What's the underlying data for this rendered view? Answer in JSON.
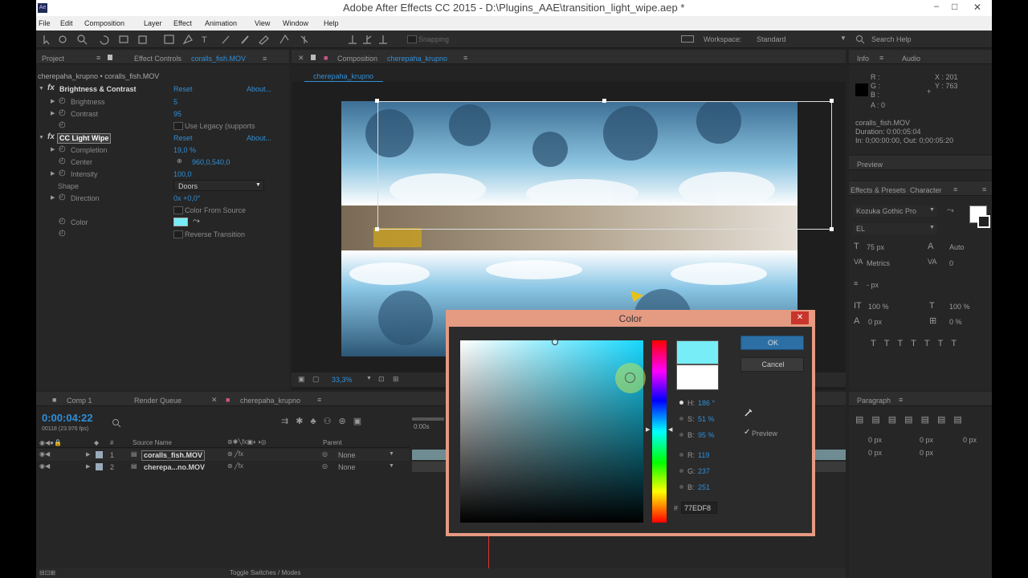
{
  "titlebar": {
    "app_icon": "Ae",
    "title": "Adobe After Effects CC 2015 - D:\\Plugins_AAE\\transition_light_wipe.aep *",
    "min": "–",
    "max": "□",
    "close": "✕"
  },
  "menu": [
    "File",
    "Edit",
    "Composition",
    "Layer",
    "Effect",
    "Animation",
    "View",
    "Window",
    "Help"
  ],
  "toolbar": {
    "snapping": "Snapping",
    "workspace_label": "Workspace:",
    "workspace_value": "Standard",
    "search": "Search Help"
  },
  "effect_controls": {
    "tab_project": "Project",
    "tab_effect": "Effect Controls",
    "tab_effect_layer": "coralls_fish.MOV",
    "breadcrumb": "cherepaha_krupno • coralls_fish.MOV",
    "effects": [
      {
        "name": "Brightness & Contrast",
        "reset": "Reset",
        "about": "About..."
      },
      {
        "name": "CC Light Wipe",
        "reset": "Reset",
        "about": "About..."
      }
    ],
    "bc_props": [
      {
        "label": "Brightness",
        "value": "5"
      },
      {
        "label": "Contrast",
        "value": "95"
      },
      {
        "label": "",
        "value": "Use Legacy (supports"
      }
    ],
    "lw_props": [
      {
        "label": "Completion",
        "value": "19,0 %"
      },
      {
        "label": "Center",
        "value": "960,0,540,0"
      },
      {
        "label": "Intensity",
        "value": "100,0"
      },
      {
        "label": "Shape",
        "value": "Doors"
      },
      {
        "label": "Direction",
        "value": "0x +0,0°"
      },
      {
        "label": "",
        "value": "Color From Source"
      },
      {
        "label": "Color",
        "value": ""
      },
      {
        "label": "",
        "value": "Reverse Transition"
      }
    ],
    "color_swatch": "#77EDF8"
  },
  "composition": {
    "tab": "Composition",
    "tab_name": "cherepaha_krupno",
    "sub_tab": "cherepaha_krupno",
    "zoom": "33,3%"
  },
  "info_panel": {
    "tab_info": "Info",
    "tab_audio": "Audio",
    "r": "R :",
    "g": "G :",
    "b": "B :",
    "a": "A : 0",
    "x": "X : 201",
    "y": "Y : 763",
    "clip": "coralls_fish.MOV",
    "duration": "Duration: 0:00:05:04",
    "inout": "In: 0;00:00:00, Out: 0;00:05:20",
    "preview_tab": "Preview"
  },
  "character_panel": {
    "tab_effects": "Effects & Presets",
    "tab_character": "Character",
    "font": "Kozuka Gothic Pro",
    "style": "EL",
    "size": "75 px",
    "leading": "Auto",
    "kerning": "Metrics",
    "tracking": "0",
    "stroke": "- px",
    "vscale": "100 %",
    "hscale": "100 %",
    "baseline": "0 px",
    "tsume": "0 %",
    "paragraph_tab": "Paragraph",
    "para_values": [
      "0 px",
      "0 px",
      "0 px",
      "0 px",
      "0 px"
    ]
  },
  "timeline": {
    "tabs": [
      "Comp 1",
      "Render Queue",
      "cherepaha_krupno"
    ],
    "timecode": "0:00:04:22",
    "fps": "00118 (23.976 fps)",
    "col_source": "Source Name",
    "col_parent": "Parent",
    "layers": [
      {
        "num": "1",
        "name": "coralls_fish.MOV",
        "parent": "None"
      },
      {
        "num": "2",
        "name": "cherepa...no.MOV",
        "parent": "None"
      }
    ],
    "toggle": "Toggle Switches / Modes",
    "ruler_start": "0:00s"
  },
  "color_dialog": {
    "title": "Color",
    "ok": "OK",
    "cancel": "Cancel",
    "preview": "Preview",
    "h_label": "H:",
    "h_value": "186 °",
    "s_label": "S:",
    "s_value": "51 %",
    "br_label": "B:",
    "br_value": "95 %",
    "r_label": "R:",
    "r_value": "119",
    "g_label": "G:",
    "g_value": "237",
    "b_label": "B:",
    "b_value": "251",
    "hex_label": "#",
    "hex_value": "77EDF8",
    "new_color": "#77EDF8",
    "old_color": "#FFFFFF"
  }
}
